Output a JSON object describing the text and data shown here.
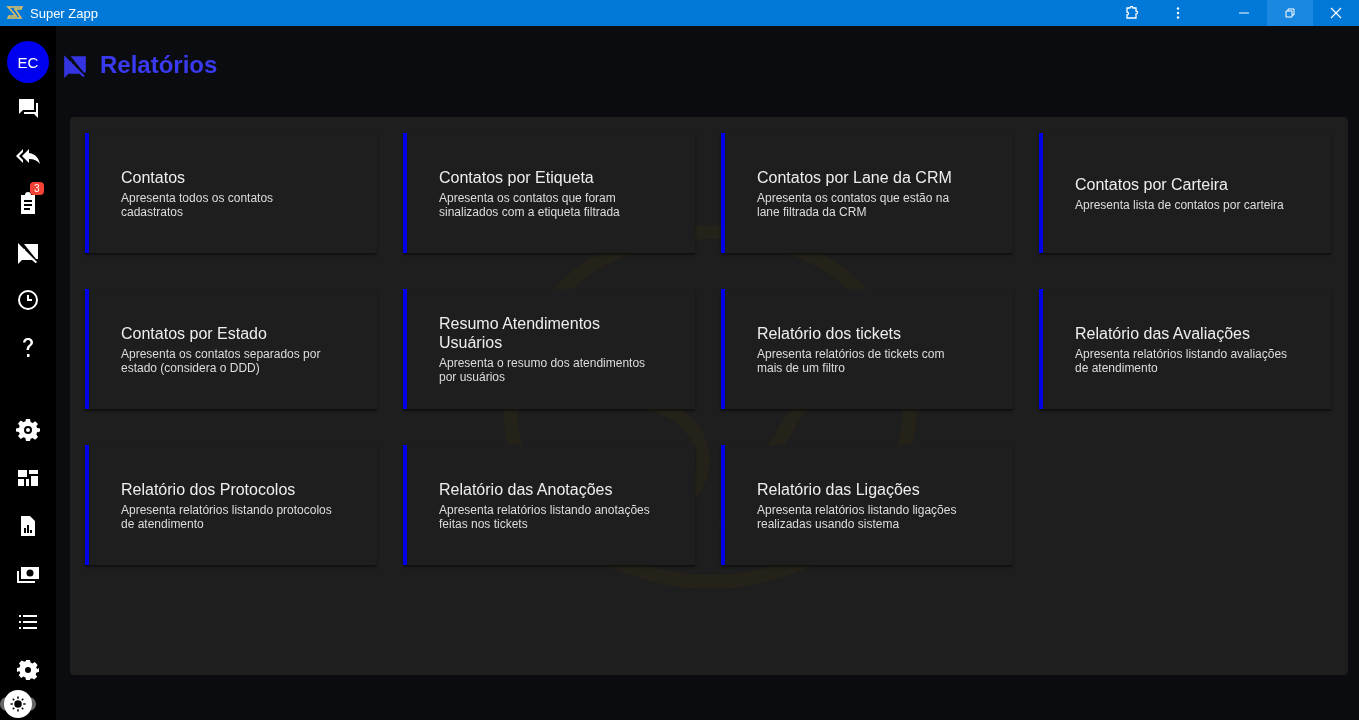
{
  "window": {
    "title": "Super Zapp"
  },
  "sidebar": {
    "avatar": "EC",
    "badge": "3",
    "theme_toggle": {
      "on": false
    }
  },
  "page": {
    "title": "Relatórios"
  },
  "reports": [
    {
      "title": "Contatos",
      "description": "Apresenta todos os contatos cadastratos"
    },
    {
      "title": "Contatos por Etiqueta",
      "description": "Apresenta os contatos que foram sinalizados com a etiqueta filtrada"
    },
    {
      "title": "Contatos por Lane da CRM",
      "description": "Apresenta os contatos que estão na lane filtrada da CRM"
    },
    {
      "title": "Contatos por Carteira",
      "description": "Apresenta lista de contatos por carteira"
    },
    {
      "title": "Contatos por Estado",
      "description": "Apresenta os contatos separados por estado (considera o DDD)"
    },
    {
      "title": "Resumo Atendimentos Usuários",
      "description": "Apresenta o resumo dos atendimentos por usuários"
    },
    {
      "title": "Relatório dos tickets",
      "description": "Apresenta relatórios de tickets com mais de um filtro"
    },
    {
      "title": "Relatório das Avaliações",
      "description": "Apresenta relatórios listando avaliações de atendimento"
    },
    {
      "title": "Relatório dos Protocolos",
      "description": "Apresenta relatórios listando protocolos de atendimento"
    },
    {
      "title": "Relatório das Anotações",
      "description": "Apresenta relatórios listando anotações feitas nos tickets"
    },
    {
      "title": "Relatório das Ligações",
      "description": "Apresenta relatórios listando ligações realizadas usando sistema"
    }
  ]
}
